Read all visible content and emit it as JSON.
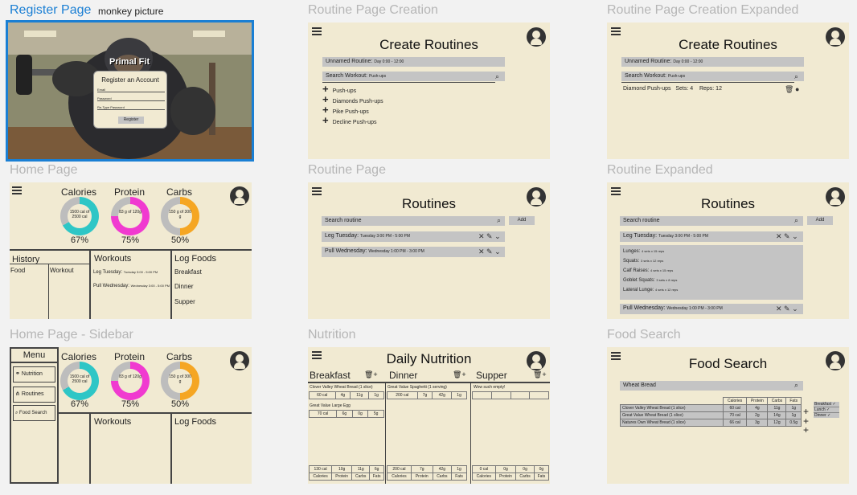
{
  "labels": {
    "register": "Register Page",
    "monkey": "monkey picture",
    "rpc": "Routine Page Creation",
    "rpce": "Routine Page Creation Expanded",
    "home": "Home Page",
    "routine": "Routine Page",
    "rexp": "Routine Expanded",
    "homeside": "Home Page - Sidebar",
    "nutrition": "Nutrition",
    "foodsearch": "Food Search"
  },
  "register": {
    "brand": "Primal Fit",
    "title": "Register an Account",
    "email": "Email",
    "password": "Password",
    "retype": "Re-Type Password",
    "button": "Register"
  },
  "create": {
    "title": "Create Routines",
    "name": "Unnamed Routine:",
    "time": "Day 0:00 - 12:00",
    "search": "Search Workout:",
    "search_val": "Push-ups",
    "items": [
      "Push-ups",
      "Diamonds Push-ups",
      "Pike Push-ups",
      "Decline Push-ups"
    ]
  },
  "create_exp": {
    "title": "Create Routines",
    "name": "Unnamed Routine:",
    "time": "Day 0:00 - 12:00",
    "search": "Search Workout:",
    "search_val": "Push-ups",
    "row": "Diamond Push-ups",
    "sets": "Sets: 4",
    "reps": "Reps: 12"
  },
  "home": {
    "cal": "Calories",
    "pro": "Protein",
    "carb": "Carbs",
    "cal_in": "1500 cal of 2500 cal",
    "pro_in": "83 g of 120g",
    "carb_in": "150 g of 300 g",
    "cal_pct": "67%",
    "pro_pct": "75%",
    "carb_pct": "50%",
    "history": "History",
    "food": "Food",
    "workout": "Workout",
    "workouts": "Workouts",
    "w1": "Leg Tuesday:",
    "w1t": "Tuesday 3:00 - 5:00 PM",
    "w2": "Pull Wednesday:",
    "w2t": "Wednesday 3:00 - 5:00 PM",
    "log": "Log Foods",
    "b": "Breakfast",
    "d": "Dinner",
    "s": "Supper"
  },
  "routines": {
    "title": "Routines",
    "search": "Search routine",
    "add": "Add",
    "r1": "Leg Tuesday:",
    "r1t": "Tuesday 3:00 PM - 5:00 PM",
    "r2": "Pull Wednesday:",
    "r2t": "Wednesday 1:00 PM - 3:00 PM"
  },
  "rexp": {
    "title": "Routines",
    "search": "Search routine",
    "add": "Add",
    "r1": "Leg Tuesday:",
    "r1t": "Tuesday 3:00 PM - 5:00 PM",
    "ex": [
      [
        "Lunges:",
        "4 sets x 15 reps"
      ],
      [
        "Squats:",
        "3 sets x 12 reps"
      ],
      [
        "Calf Raises:",
        "4 sets x 15 reps"
      ],
      [
        "Goblet Squats:",
        "3 sets x 8 reps"
      ],
      [
        "Lateral Lunge:",
        "4 sets x 12 reps"
      ]
    ],
    "r2": "Pull Wednesday:",
    "r2t": "Wednesday 1:00 PM - 3:00 PM"
  },
  "side": {
    "menu": "Menu",
    "nut": "Nutrition",
    "rout": "Routines",
    "food": "Food Search",
    "cal": "Calories",
    "pro": "Protein",
    "carb": "Carbs",
    "cal_in": "1500 cal of 2500 cal",
    "pro_in": "83 g of 120g",
    "carb_in": "150 g of 300 g",
    "cal_pct": "67%",
    "pro_pct": "75%",
    "carb_pct": "50%",
    "workouts": "Workouts",
    "log": "Log Foods"
  },
  "nut": {
    "title": "Daily Nutrition",
    "b": "Breakfast",
    "d": "Dinner",
    "s": "Supper",
    "b1": "Clover Valley Wheat Bread (1 slice)",
    "b1v": [
      "60 cal",
      "4g",
      "11g",
      "1g"
    ],
    "b2": "Great Value Large Egg",
    "b2v": [
      "70 cal",
      "6g",
      "0g",
      "5g"
    ],
    "d1": "Great Value Spaghetti (1 serving)",
    "d1v": [
      "200 cal",
      "7g",
      "42g",
      "1g"
    ],
    "s1": "Wow such empty!",
    "bt": [
      "130 cal",
      "10g",
      "11g",
      "6g"
    ],
    "dt": [
      "200 cal",
      "7g",
      "42g",
      "1g"
    ],
    "st": [
      "0 cal",
      "0g",
      "0g",
      "0g"
    ],
    "hdr": [
      "Calories",
      "Protein",
      "Carbs",
      "Fats"
    ]
  },
  "fs": {
    "title": "Food Search",
    "search": "Wheat Bread",
    "hdr": [
      "Calories",
      "Protein",
      "Carbs",
      "Fats"
    ],
    "rows": [
      [
        "Clover Valley Wheat Bread (1 slice)",
        "60 cal",
        "4g",
        "11g",
        "1g"
      ],
      [
        "Great Value Wheat Bread (1 slice)",
        "70 cal",
        "2g",
        "14g",
        "1g"
      ],
      [
        "Natures Own Wheat Bread (1 slice)",
        "66 cal",
        "3g",
        "12g",
        "0.5g"
      ]
    ],
    "menu": [
      "Breakfast",
      "Lunch",
      "Dinner"
    ]
  }
}
